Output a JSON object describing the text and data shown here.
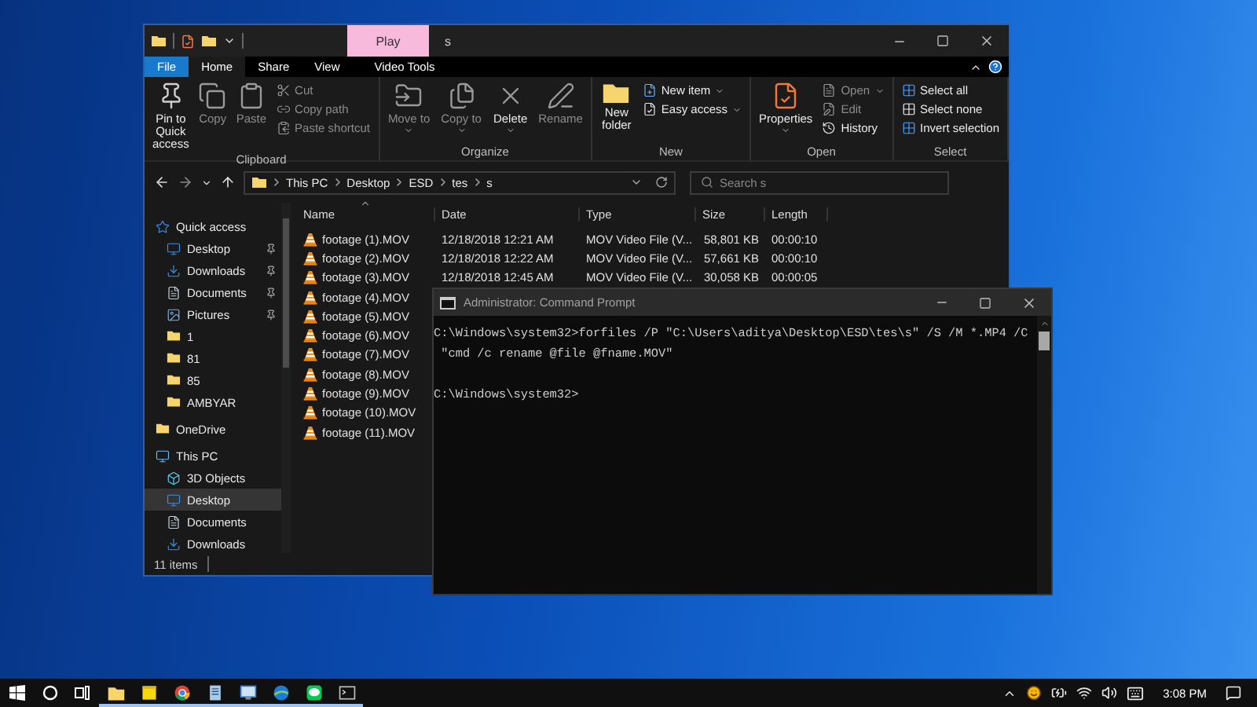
{
  "explorer": {
    "context_tab": "Play",
    "title": "s",
    "ribbon_tabs": [
      {
        "label": "File",
        "kind": "file",
        "selected": false
      },
      {
        "label": "Home",
        "kind": "tab",
        "selected": true
      },
      {
        "label": "Share",
        "kind": "tab",
        "selected": false
      },
      {
        "label": "View",
        "kind": "tab",
        "selected": false
      },
      {
        "label": "Video Tools",
        "kind": "context",
        "selected": false
      }
    ],
    "ribbon_groups": [
      {
        "label": "Clipboard",
        "items": [
          {
            "kind": "large",
            "label": "Pin to Quick access",
            "disabled": false,
            "dropdown": false
          },
          {
            "kind": "large",
            "label": "Copy",
            "disabled": true,
            "dropdown": false
          },
          {
            "kind": "large",
            "label": "Paste",
            "disabled": true,
            "dropdown": false
          },
          {
            "kind": "stack",
            "items": [
              {
                "label": "Cut",
                "disabled": true,
                "dropdown": false
              },
              {
                "label": "Copy path",
                "disabled": true,
                "dropdown": false
              },
              {
                "label": "Paste shortcut",
                "disabled": true,
                "dropdown": false
              }
            ]
          }
        ]
      },
      {
        "label": "Organize",
        "items": [
          {
            "kind": "large",
            "label": "Move to",
            "disabled": true,
            "dropdown": true
          },
          {
            "kind": "large",
            "label": "Copy to",
            "disabled": true,
            "dropdown": true
          },
          {
            "kind": "large",
            "label": "Delete",
            "disabled": false,
            "dropdown": true
          },
          {
            "kind": "large",
            "label": "Rename",
            "disabled": true,
            "dropdown": false
          }
        ]
      },
      {
        "label": "New",
        "items": [
          {
            "kind": "large",
            "label": "New folder",
            "disabled": false,
            "dropdown": false
          },
          {
            "kind": "stack",
            "items": [
              {
                "label": "New item",
                "disabled": false,
                "dropdown": true
              },
              {
                "label": "Easy access",
                "disabled": false,
                "dropdown": true
              }
            ]
          }
        ]
      },
      {
        "label": "Open",
        "items": [
          {
            "kind": "large",
            "label": "Properties",
            "disabled": false,
            "dropdown": true
          },
          {
            "kind": "stack",
            "items": [
              {
                "label": "Open",
                "disabled": true,
                "dropdown": true
              },
              {
                "label": "Edit",
                "disabled": true,
                "dropdown": false
              },
              {
                "label": "History",
                "disabled": false,
                "dropdown": false
              }
            ]
          }
        ]
      },
      {
        "label": "Select",
        "items": [
          {
            "kind": "stack",
            "items": [
              {
                "label": "Select all",
                "disabled": false,
                "dropdown": false
              },
              {
                "label": "Select none",
                "disabled": false,
                "dropdown": false
              },
              {
                "label": "Invert selection",
                "disabled": false,
                "dropdown": false
              }
            ]
          }
        ]
      }
    ],
    "breadcrumb": [
      "This PC",
      "Desktop",
      "ESD",
      "tes",
      "s"
    ],
    "search": {
      "placeholder": "Search s"
    },
    "nav": [
      {
        "label": "Quick access",
        "selected": false,
        "pinned": false,
        "children": [
          {
            "label": "Desktop",
            "selected": false,
            "pinned": true
          },
          {
            "label": "Downloads",
            "selected": false,
            "pinned": true
          },
          {
            "label": "Documents",
            "selected": false,
            "pinned": true
          },
          {
            "label": "Pictures",
            "selected": false,
            "pinned": true
          },
          {
            "label": "1",
            "selected": false,
            "pinned": false
          },
          {
            "label": "81",
            "selected": false,
            "pinned": false
          },
          {
            "label": "85",
            "selected": false,
            "pinned": false
          },
          {
            "label": "AMBYAR",
            "selected": false,
            "pinned": false
          }
        ]
      },
      {
        "label": "OneDrive",
        "selected": false,
        "pinned": false
      },
      {
        "label": "This PC",
        "selected": false,
        "pinned": false,
        "children": [
          {
            "label": "3D Objects",
            "selected": false,
            "pinned": false
          },
          {
            "label": "Desktop",
            "selected": true,
            "pinned": false
          },
          {
            "label": "Documents",
            "selected": false,
            "pinned": false
          },
          {
            "label": "Downloads",
            "selected": false,
            "pinned": false
          }
        ]
      }
    ],
    "columns": [
      "Name",
      "Date",
      "Type",
      "Size",
      "Length"
    ],
    "rows": [
      {
        "name": "footage (1).MOV",
        "date": "12/18/2018 12:21 AM",
        "type": "MOV Video File (V...",
        "size": "58,801 KB",
        "length": "00:00:10"
      },
      {
        "name": "footage (2).MOV",
        "date": "12/18/2018 12:22 AM",
        "type": "MOV Video File (V...",
        "size": "57,661 KB",
        "length": "00:00:10"
      },
      {
        "name": "footage (3).MOV",
        "date": "12/18/2018 12:45 AM",
        "type": "MOV Video File (V...",
        "size": "30,058 KB",
        "length": "00:00:05"
      },
      {
        "name": "footage (4).MOV"
      },
      {
        "name": "footage (5).MOV"
      },
      {
        "name": "footage (6).MOV"
      },
      {
        "name": "footage (7).MOV"
      },
      {
        "name": "footage (8).MOV"
      },
      {
        "name": "footage (9).MOV"
      },
      {
        "name": "footage (10).MOV"
      },
      {
        "name": "footage (11).MOV"
      }
    ],
    "status": "11 items"
  },
  "cmd": {
    "title": "Administrator: Command Prompt",
    "blocks": [
      [
        "C:\\Windows\\system32>forfiles /P \"C:\\Users\\aditya\\Desktop\\ESD\\tes\\s\" /S /M *.MP4 /C",
        " \"cmd /c rename @file @fname.MOV\""
      ],
      [
        "C:\\Windows\\system32>"
      ]
    ]
  },
  "taskbar": {
    "apps": [
      {
        "kind": "explorer",
        "running": true
      },
      {
        "kind": "sticky",
        "running": true
      },
      {
        "kind": "chrome",
        "running": true
      },
      {
        "kind": "notepad",
        "running": true
      },
      {
        "kind": "remote",
        "running": true
      },
      {
        "kind": "browser",
        "running": true
      },
      {
        "kind": "chat",
        "running": true
      },
      {
        "kind": "terminal",
        "running": true
      }
    ],
    "time": "3:08 PM"
  }
}
